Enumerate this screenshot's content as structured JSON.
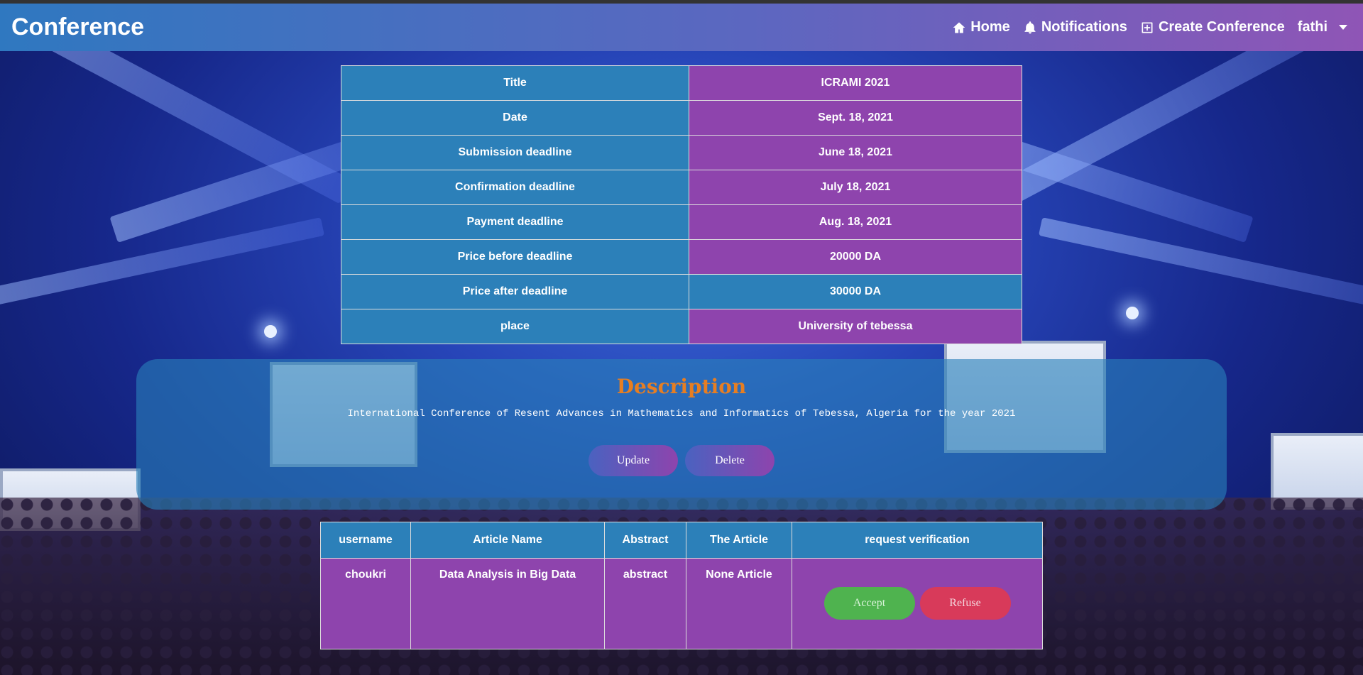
{
  "colors": {
    "navbar_start": "#2f78c0",
    "navbar_end": "#8f55b6",
    "key_cell": "#2c80b9",
    "value_cell": "#8e44ad",
    "description_title": "#e67e22",
    "accept": "#4fb34f",
    "refuse": "#d83a5a"
  },
  "navbar": {
    "brand": "Conference",
    "links": [
      {
        "label": "Home",
        "icon": "home-icon"
      },
      {
        "label": "Notifications",
        "icon": "bell-icon"
      },
      {
        "label": "Create Conference",
        "icon": "plus-square-icon"
      }
    ],
    "user": "fathi"
  },
  "conference_details": [
    {
      "label": "Title",
      "value": "ICRAMI 2021"
    },
    {
      "label": "Date",
      "value": "Sept. 18, 2021"
    },
    {
      "label": "Submission deadline",
      "value": "June 18, 2021"
    },
    {
      "label": "Confirmation deadline",
      "value": "July 18, 2021"
    },
    {
      "label": "Payment deadline",
      "value": "Aug. 18, 2021"
    },
    {
      "label": "Price before deadline",
      "value": "20000 DA"
    },
    {
      "label": "Price after deadline",
      "value": "30000 DA"
    },
    {
      "label": "place",
      "value": "University of tebessa"
    }
  ],
  "description": {
    "title": "Description",
    "text": "International Conference of Resent Advances in Mathematics and Informatics of Tebessa, Algeria for the year 2021",
    "update_label": "Update",
    "delete_label": "Delete"
  },
  "requests": {
    "headers": [
      "username",
      "Article Name",
      "Abstract",
      "The Article",
      "request verification"
    ],
    "rows": [
      {
        "username": "choukri",
        "article_name": "Data Analysis in Big Data",
        "abstract": "abstract",
        "article": "None Article"
      }
    ],
    "accept_label": "Accept",
    "refuse_label": "Refuse"
  }
}
